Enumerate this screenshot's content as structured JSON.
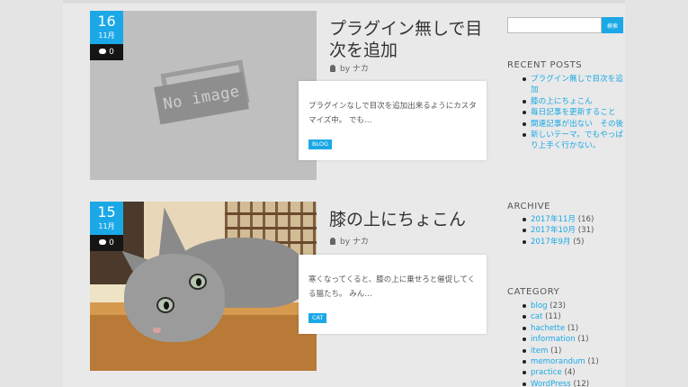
{
  "posts": [
    {
      "day": "16",
      "month": "11月",
      "comments": "0",
      "image": "No image",
      "title": "プラグイン無しで目次を追加",
      "author_prefix": "by",
      "author": "ナカ",
      "excerpt": "プラグインなしで目次を追加出来るようにカスタマイズ中。 でも…",
      "tag": "BLOG"
    },
    {
      "day": "15",
      "month": "11月",
      "comments": "0",
      "title": "膝の上にちょこん",
      "author_prefix": "by",
      "author": "ナカ",
      "excerpt": "寒くなってくると、膝の上に乗せろと催促してくる猫たち。 みん…",
      "tag": "CAT"
    }
  ],
  "sidebar": {
    "search": {
      "value": "",
      "button_label": "検索"
    },
    "recent_title": "RECENT POSTS",
    "recent_posts": [
      "プラグイン無しで目次を追加",
      "膝の上にちょこん",
      "毎日記事を更新すること",
      "関連記事が出ない　その後",
      "新しいテーマ。でもやっぱり上手く行かない。"
    ],
    "archive_title": "ARCHIVE",
    "archives": [
      {
        "label": "2017年11月",
        "count": "(16)"
      },
      {
        "label": "2017年10月",
        "count": "(31)"
      },
      {
        "label": "2017年9月",
        "count": "(5)"
      }
    ],
    "category_title": "CATEGORY",
    "categories": [
      {
        "label": "blog",
        "count": "(23)"
      },
      {
        "label": "cat",
        "count": "(11)"
      },
      {
        "label": "hachette",
        "count": "(1)"
      },
      {
        "label": "information",
        "count": "(1)"
      },
      {
        "label": "item",
        "count": "(1)"
      },
      {
        "label": "memorandum",
        "count": "(1)"
      },
      {
        "label": "practice",
        "count": "(4)"
      },
      {
        "label": "WordPress",
        "count": "(12)"
      }
    ]
  },
  "colors": {
    "accent": "#1ba8e6",
    "background": "#e9e9e9"
  }
}
